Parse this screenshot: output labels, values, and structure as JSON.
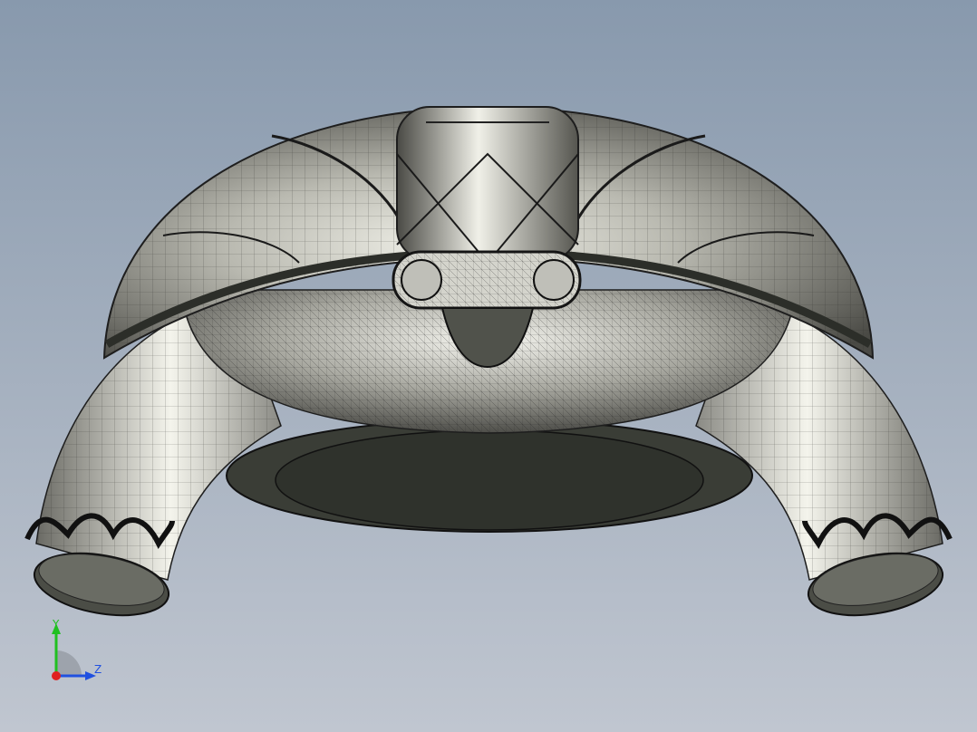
{
  "viewport": {
    "background_top": "#8899ad",
    "background_bottom": "#c0c6d0"
  },
  "model": {
    "shading": "shaded-with-edges",
    "body_color": "#d8d8d0",
    "edge_color": "#1e1e1e",
    "base_color": "#3c3f38"
  },
  "triad": {
    "y_label": "Y",
    "z_label": "Z",
    "x_color": "#e02020",
    "y_color": "#20c020",
    "z_color": "#2050e0"
  }
}
